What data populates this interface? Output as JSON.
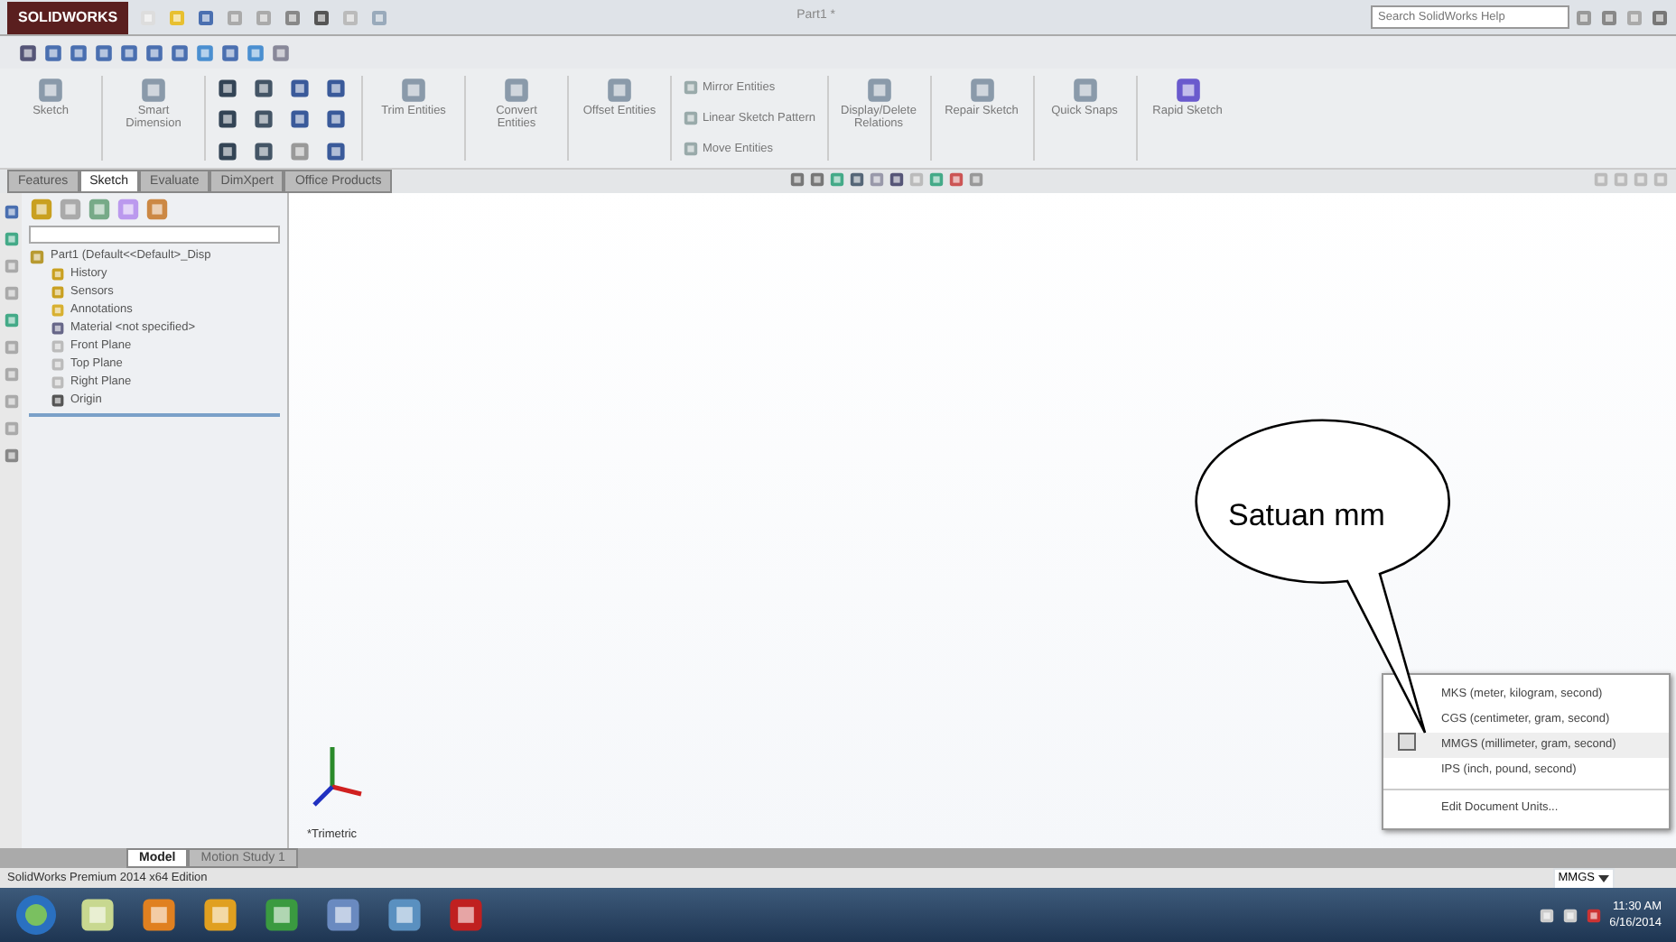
{
  "title_bar": {
    "app": "SOLIDWORKS",
    "document": "Part1 *",
    "search_placeholder": "Search SolidWorks Help"
  },
  "ribbon": [
    {
      "label": "Sketch",
      "kind": "large"
    },
    {
      "label": "Smart Dimension",
      "kind": "large"
    },
    {
      "kind": "tools"
    },
    {
      "label": "Trim Entities",
      "kind": "large"
    },
    {
      "label": "Convert Entities",
      "kind": "large"
    },
    {
      "label": "Offset Entities",
      "kind": "large"
    },
    {
      "kind": "stack",
      "items": [
        "Mirror Entities",
        "Linear Sketch Pattern",
        "Move Entities"
      ]
    },
    {
      "label": "Display/Delete Relations",
      "kind": "large"
    },
    {
      "label": "Repair Sketch",
      "kind": "large"
    },
    {
      "label": "Quick Snaps",
      "kind": "large"
    },
    {
      "label": "Rapid Sketch",
      "kind": "large"
    }
  ],
  "command_tabs": [
    {
      "label": "Features",
      "selected": false
    },
    {
      "label": "Sketch",
      "selected": true
    },
    {
      "label": "Evaluate",
      "selected": false
    },
    {
      "label": "DimXpert",
      "selected": false
    },
    {
      "label": "Office Products",
      "selected": false
    }
  ],
  "feature_tree": {
    "root": "Part1  (Default<<Default>_Disp",
    "children": [
      {
        "label": "History"
      },
      {
        "label": "Sensors"
      },
      {
        "label": "Annotations"
      },
      {
        "label": "Material <not specified>"
      },
      {
        "label": "Front Plane"
      },
      {
        "label": "Top Plane"
      },
      {
        "label": "Right Plane"
      },
      {
        "label": "Origin"
      }
    ]
  },
  "viewport": {
    "view_label": "*Trimetric"
  },
  "bottom_tabs": [
    {
      "label": "Model",
      "selected": true
    },
    {
      "label": "Motion Study 1",
      "selected": false
    }
  ],
  "units_menu": {
    "items": [
      {
        "label": "MKS  (meter, kilogram, second)",
        "selected": false
      },
      {
        "label": "CGS  (centimeter, gram, second)",
        "selected": false
      },
      {
        "label": "MMGS  (millimeter, gram, second)",
        "selected": true
      },
      {
        "label": "IPS  (inch, pound, second)",
        "selected": false
      }
    ],
    "edit": "Edit Document Units..."
  },
  "callout": {
    "text": "Satuan mm"
  },
  "status_bar": {
    "text": "SolidWorks Premium 2014 x64 Edition",
    "units": "MMGS"
  },
  "taskbar": {
    "time": "11:30 AM",
    "date": "6/16/2014"
  }
}
